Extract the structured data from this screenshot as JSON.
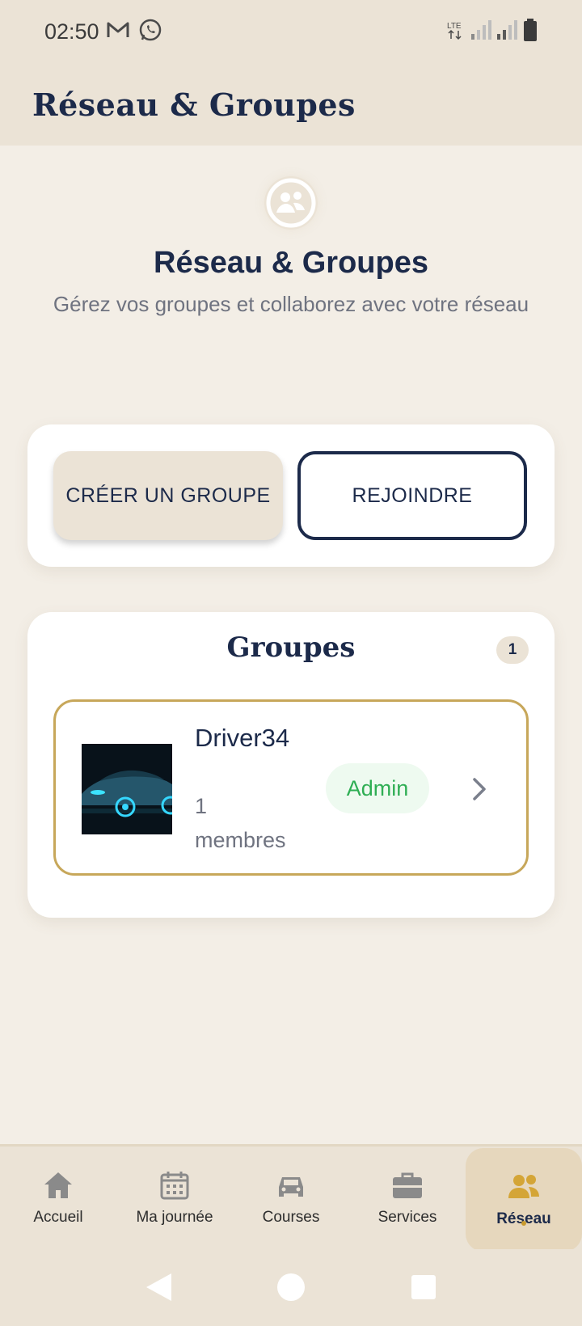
{
  "status_bar": {
    "time": "02:50",
    "icons_left": [
      "gmail-icon",
      "whatsapp-icon"
    ],
    "icons_right": [
      "lte-icon",
      "signal-icon",
      "signal-icon",
      "battery-icon"
    ]
  },
  "header": {
    "title": "Réseau & Groupes"
  },
  "hero": {
    "icon": "users-circle-icon",
    "title": "Réseau & Groupes",
    "subtitle": "Gérez vos groupes et collaborez avec votre réseau"
  },
  "actions": {
    "create_label": "CRÉER UN GROUPE",
    "join_label": "REJOINDRE"
  },
  "groups": {
    "title": "Groupes",
    "count": "1",
    "items": [
      {
        "name": "Driver34",
        "members": "1 membres",
        "role": "Admin"
      }
    ]
  },
  "bottom_nav": {
    "items": [
      {
        "label": "Accueil",
        "icon": "home-icon"
      },
      {
        "label": "Ma journée",
        "icon": "calendar-icon"
      },
      {
        "label": "Courses",
        "icon": "car-icon"
      },
      {
        "label": "Services",
        "icon": "briefcase-icon"
      },
      {
        "label": "Réseau",
        "icon": "users-icon"
      }
    ],
    "active_index": 4
  },
  "colors": {
    "navy": "#1c2a4a",
    "beige": "#ebe3d6",
    "background": "#f3eee6",
    "gold": "#c7a75a",
    "admin_green": "#2fae54",
    "active_nav_icon": "#d4a537"
  }
}
